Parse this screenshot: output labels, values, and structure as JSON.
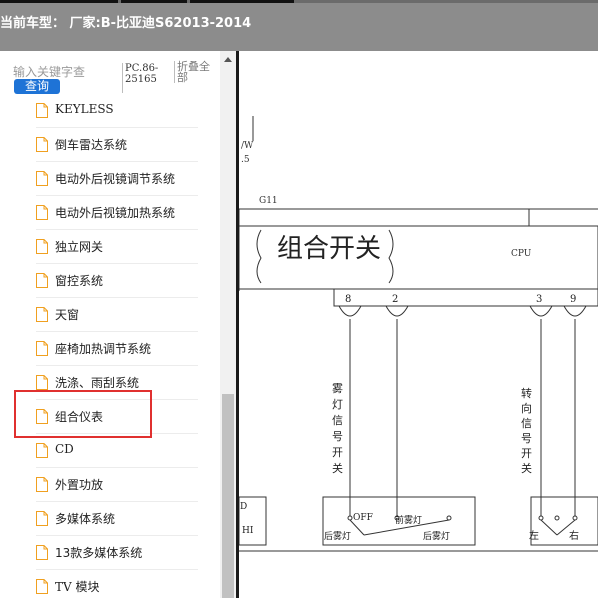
{
  "header": {
    "title": "当前车型：  厂家:B-比亚迪S62013-2014"
  },
  "sidebar": {
    "search_placeholder": "输入关键字查",
    "query_label": "查询",
    "code_line1": "PC.86-",
    "code_line2": "25165",
    "collapse_line1": "折叠全",
    "collapse_line2": "部",
    "items": [
      {
        "label": "KEYLESS"
      },
      {
        "label": "倒车雷达系统"
      },
      {
        "label": "电动外后视镜调节系统"
      },
      {
        "label": "电动外后视镜加热系统"
      },
      {
        "label": "独立网关"
      },
      {
        "label": "窗控系统"
      },
      {
        "label": "天窗"
      },
      {
        "label": "座椅加热调节系统"
      },
      {
        "label": "洗涤、雨刮系统"
      },
      {
        "label": "组合仪表"
      },
      {
        "label": "CD"
      },
      {
        "label": "外置功放"
      },
      {
        "label": "多媒体系统"
      },
      {
        "label": "13款多媒体系统"
      },
      {
        "label": "TV 模块"
      }
    ],
    "highlighted_index": 9
  },
  "diagram": {
    "wire_label_fraction": "/W",
    "wire_label_gauge": ".5",
    "connector": "G11",
    "module_title": "组合开关",
    "cpu_label": "CPU",
    "pins": [
      "8",
      "2",
      "3",
      "9"
    ],
    "fog_label": "雾灯信号开关",
    "turn_label": "转向信号开关",
    "left_edge_d": "D",
    "left_edge_hi": "HI",
    "fog_off": "OFF",
    "fog_front": "前雾灯",
    "fog_rear_left": "后雾灯",
    "fog_rear_right": "后雾灯",
    "turn_left": "左",
    "turn_right": "右"
  },
  "colors": {
    "header_bg": "#8c8c8c",
    "query_button": "#1e73d6",
    "highlight_border": "#e0302f"
  }
}
